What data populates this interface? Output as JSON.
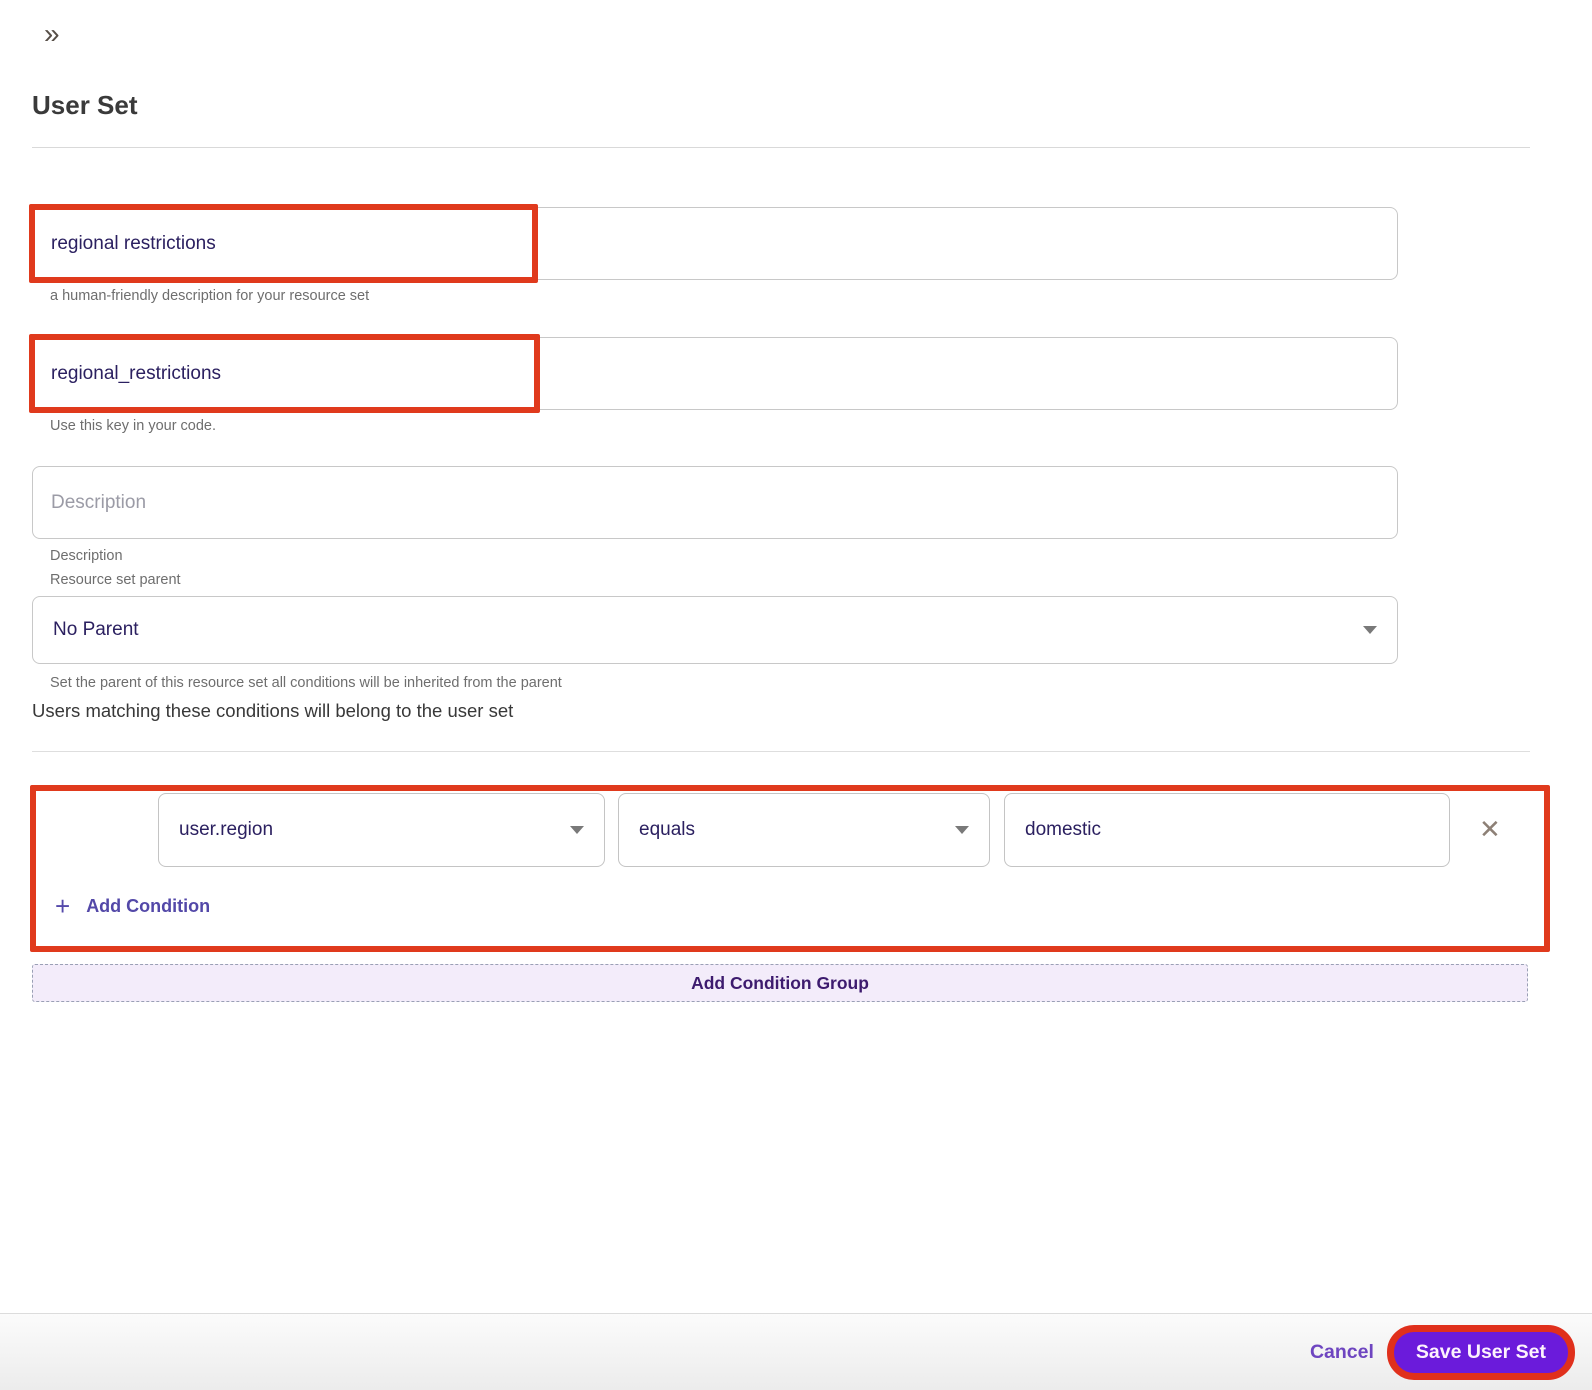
{
  "header": {
    "collapse_icon": "»",
    "title": "User Set"
  },
  "form": {
    "name_field": {
      "value": "regional restrictions",
      "helper": "a human-friendly description for your resource set"
    },
    "key_field": {
      "value": "regional_restrictions",
      "helper": "Use this key in your code."
    },
    "description_field": {
      "placeholder": "Description",
      "label": "Description"
    },
    "parent_field": {
      "label": "Resource set parent",
      "value": "No Parent",
      "helper": "Set the parent of this resource set all conditions will be inherited from the parent"
    }
  },
  "conditions": {
    "intro": "Users matching these conditions will belong to the user set",
    "rows": [
      {
        "attribute": "user.region",
        "operator": "equals",
        "value": "domestic"
      }
    ],
    "add_condition": {
      "plus_icon": "+",
      "label": "Add Condition"
    },
    "add_group_label": "Add Condition Group",
    "remove_icon": "✕"
  },
  "footer": {
    "cancel_label": "Cancel",
    "save_label": "Save User Set"
  },
  "colors": {
    "annotation_red": "#e03a1d",
    "primary_purple": "#6b1bdb",
    "link_purple": "#6e45c0",
    "value_text": "#2b2060",
    "lavender_bg": "#f3ecfa"
  }
}
